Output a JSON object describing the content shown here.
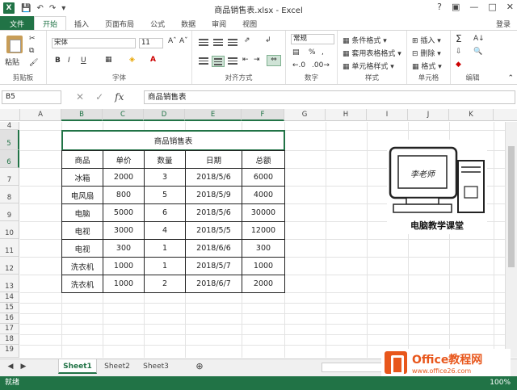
{
  "window": {
    "title": "商品销售表.xlsx - Excel",
    "login": "登录",
    "app_logo": "X"
  },
  "tabs": [
    "文件",
    "开始",
    "插入",
    "页面布局",
    "公式",
    "数据",
    "审阅",
    "视图"
  ],
  "ribbon": {
    "clipboard": {
      "paste": "粘贴",
      "label": "剪贴板"
    },
    "font": {
      "name": "宋体",
      "size": "11",
      "bold": "B",
      "italic": "I",
      "underline": "U",
      "label": "字体"
    },
    "alignment": {
      "label": "对齐方式"
    },
    "number": {
      "format": "常规",
      "label": "数字"
    },
    "styles": {
      "conditional": "条件格式",
      "table": "套用表格格式",
      "cell": "单元格样式",
      "label": "样式"
    },
    "cells": {
      "insert": "插入",
      "delete": "删除",
      "format": "格式",
      "label": "单元格"
    },
    "editing": {
      "label": "编辑"
    }
  },
  "formula_bar": {
    "name_box": "B5",
    "value": "商品销售表",
    "fx": "fx"
  },
  "columns": [
    "A",
    "B",
    "C",
    "D",
    "E",
    "F",
    "G",
    "H",
    "I",
    "J",
    "K"
  ],
  "rows": [
    "4",
    "5",
    "6",
    "7",
    "8",
    "9",
    "10",
    "11",
    "12",
    "13",
    "14",
    "15",
    "16",
    "17",
    "18",
    "19"
  ],
  "table": {
    "title": "商品销售表",
    "headers": [
      "商品",
      "单价",
      "数量",
      "日期",
      "总额"
    ],
    "rows": [
      [
        "冰箱",
        "2000",
        "3",
        "2018/5/6",
        "6000"
      ],
      [
        "电风扇",
        "800",
        "5",
        "2018/5/9",
        "4000"
      ],
      [
        "电脑",
        "5000",
        "6",
        "2018/5/6",
        "30000"
      ],
      [
        "电视",
        "3000",
        "4",
        "2018/5/5",
        "12000"
      ],
      [
        "电视",
        "300",
        "1",
        "2018/6/6",
        "300"
      ],
      [
        "洗衣机",
        "1000",
        "1",
        "2018/5/7",
        "1000"
      ],
      [
        "洗衣机",
        "1000",
        "2",
        "2018/6/7",
        "2000"
      ]
    ]
  },
  "picture": {
    "screen_text": "李老师",
    "caption": "电脑教学课堂"
  },
  "sheets": [
    "Sheet1",
    "Sheet2",
    "Sheet3"
  ],
  "status": {
    "text": "就绪",
    "zoom": "100%"
  },
  "watermark": {
    "brand": "Office教程网",
    "url": "www.office26.com"
  },
  "accent_color": "#217346"
}
